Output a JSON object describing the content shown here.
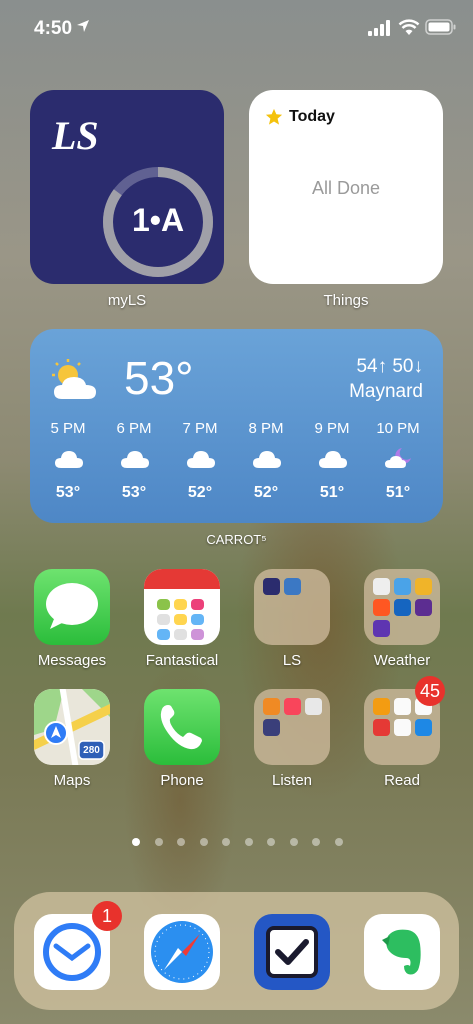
{
  "status_bar": {
    "time": "4:50"
  },
  "widgets": {
    "myls": {
      "logo_text": "LS",
      "ring_text": "1•A",
      "ring_progress": 0.85,
      "label": "myLS"
    },
    "things": {
      "title": "Today",
      "status": "All Done",
      "label": "Things"
    },
    "weather": {
      "temp": "53°",
      "hi_lo": "54↑ 50↓",
      "location": "Maynard",
      "label": "CARROT⁵",
      "hours": [
        {
          "time": "5 PM",
          "icon": "cloud-icon",
          "temp": "53°"
        },
        {
          "time": "6 PM",
          "icon": "cloud-icon",
          "temp": "53°"
        },
        {
          "time": "7 PM",
          "icon": "cloud-icon",
          "temp": "52°"
        },
        {
          "time": "8 PM",
          "icon": "cloud-icon",
          "temp": "52°"
        },
        {
          "time": "9 PM",
          "icon": "cloud-icon",
          "temp": "51°"
        },
        {
          "time": "10 PM",
          "icon": "moon-cloud-icon",
          "temp": "51°"
        }
      ]
    }
  },
  "apps": {
    "messages": {
      "label": "Messages"
    },
    "fantastical": {
      "label": "Fantastical"
    },
    "ls_folder": {
      "label": "LS"
    },
    "weather_folder": {
      "label": "Weather"
    },
    "maps": {
      "label": "Maps",
      "shield": "280"
    },
    "phone": {
      "label": "Phone"
    },
    "listen_folder": {
      "label": "Listen"
    },
    "read_folder": {
      "label": "Read",
      "badge": "45"
    }
  },
  "page_dots": {
    "count": 10,
    "active": 0
  },
  "dock": {
    "mail_badge": "1"
  },
  "colors": {
    "myls_bg": "#2b2c6e",
    "weather_top": "#6aa3d8",
    "weather_bottom": "#4e87c6",
    "badge": "#e8322c"
  }
}
